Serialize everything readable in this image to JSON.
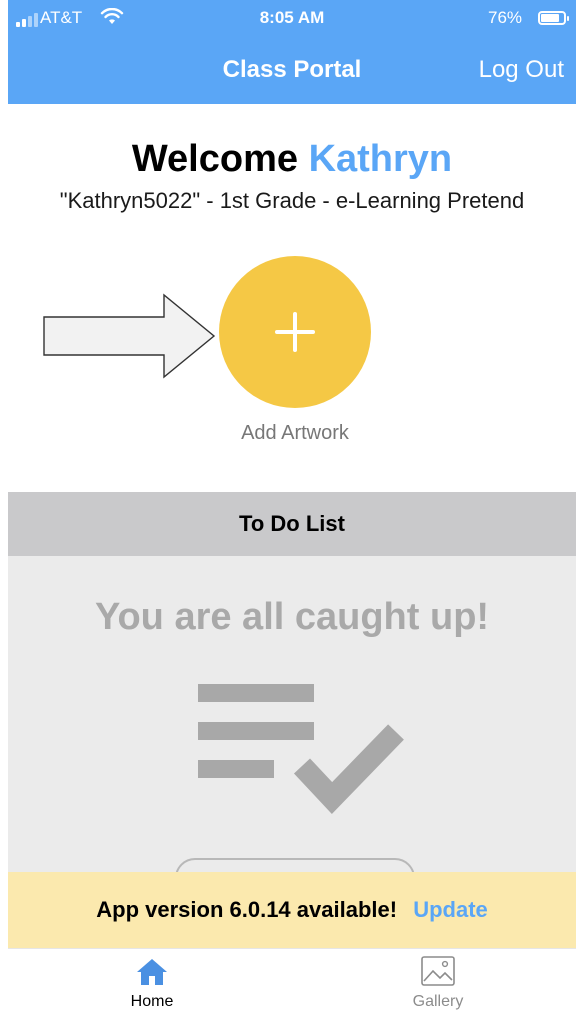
{
  "status_bar": {
    "carrier": "AT&T",
    "time": "8:05 AM",
    "battery": "76%"
  },
  "header": {
    "title": "Class Portal",
    "logout_label": "Log Out"
  },
  "welcome": {
    "greeting": "Welcome",
    "name": "Kathryn",
    "subtitle": "\"Kathryn5022\" - 1st Grade - e-Learning Pretend"
  },
  "add_artwork": {
    "label": "Add Artwork",
    "icon": "plus-icon"
  },
  "todo": {
    "header": "To Do List",
    "empty_message": "You are all caught up!",
    "icon": "checklist-icon"
  },
  "update_banner": {
    "message": "App version 6.0.14 available!",
    "action_label": "Update"
  },
  "tabs": [
    {
      "label": "Home",
      "icon": "home-icon",
      "active": true
    },
    {
      "label": "Gallery",
      "icon": "gallery-icon",
      "active": false
    }
  ],
  "colors": {
    "brand_blue": "#5aa6f6",
    "add_button_yellow": "#f5c845",
    "banner_yellow": "#fbe9ae",
    "todo_header_gray": "#c9c9cb"
  }
}
